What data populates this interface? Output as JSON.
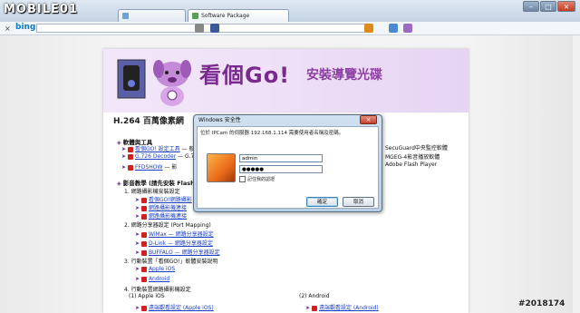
{
  "browser": {
    "logo": "MOBILE01",
    "tabs": [
      {
        "label": ""
      },
      {
        "label": "Software Package"
      }
    ],
    "toolbar": {
      "search_brand": "bing",
      "close_glyph": "×"
    },
    "window_buttons": [
      "–",
      "□",
      "×"
    ]
  },
  "page": {
    "banner": {
      "title": "看個Go!",
      "subtitle": "安裝導覽光碟"
    },
    "product_heading": "H.264 百萬像素網",
    "tools": {
      "heading": "軟體與工具",
      "items": [
        {
          "label": "看個GO! 設定工具",
          "suffix": "— 般…"
        },
        {
          "label": "G.726 Decoder",
          "suffix": "— G.7…"
        },
        {
          "label": "FFDSHOW",
          "suffix": "— 影"
        }
      ],
      "right_items": [
        "SecuGuard中央監控軟體",
        "MGEG-4影音播放軟體",
        "Adobe Flash Player"
      ]
    },
    "video_section": {
      "heading": "影音教學 (請先安裝 Flash",
      "steps": [
        {
          "title": "1. 網路攝影機安裝設定",
          "links": [
            "看個GO!網路攝影",
            "網路攝影機連接",
            "網路攝影機連接"
          ]
        },
        {
          "title": "2. 網路分享器設定 (Port Mapping)",
          "links": [
            "WiMax — 網路分享器設定",
            "D-Link — 網路分享器設定",
            "BUFFALO — 網路分享器設定"
          ]
        },
        {
          "title": "3. 行動裝置「看個GO!」軟體安裝說明",
          "links": [
            "Apple iOS",
            "Android"
          ]
        },
        {
          "title": "4. 行動裝置網路攝影機設定",
          "links": []
        }
      ],
      "sub_columns": [
        "(1) Apple iOS",
        "(2) Android"
      ],
      "sub_links": [
        "遠端觀看設定 (Apple iOS)",
        "遠端觀看設定 (Android)"
      ]
    }
  },
  "dialog": {
    "title": "Windows 安全性",
    "close_glyph": "×",
    "message": "位於 IPCam 的伺服器 192.168.1.114 需要使用者名稱及密碼。",
    "username": "admin",
    "password": "●●●●●",
    "remember_label": "記住我的認證",
    "ok_label": "確定",
    "cancel_label": "取消"
  },
  "watermark": "#2018174",
  "colors": {
    "accent": "#7a2a8f",
    "link": "#1a3fc5",
    "banner_bg": "#efe2f8"
  }
}
